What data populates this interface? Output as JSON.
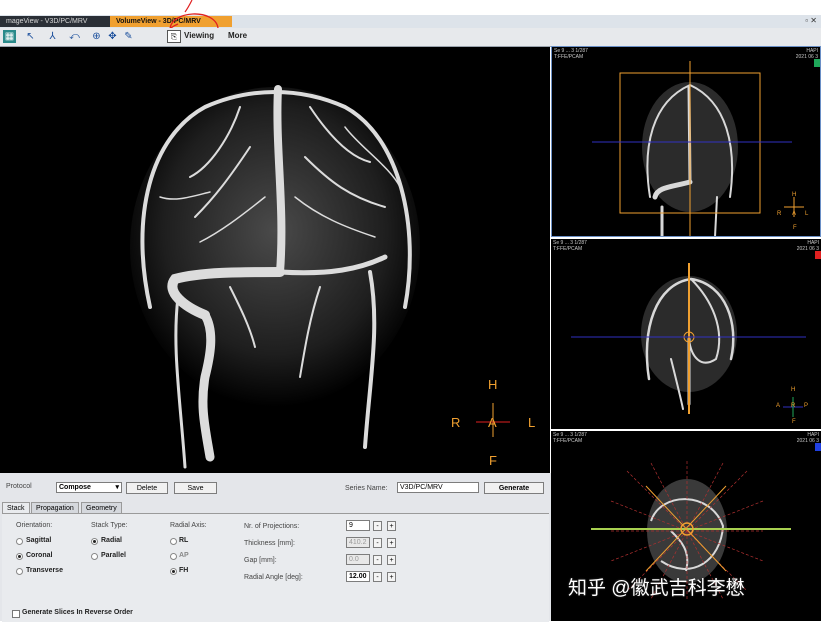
{
  "tabs": [
    {
      "label": "mageView - V3D/PC/MRV",
      "active": false
    },
    {
      "label": "VolumeView - 3D/PC/MRV",
      "active": true
    }
  ],
  "toolbar": {
    "viewing_label": "Viewing",
    "more_label": "More",
    "icons": [
      "layout-icon",
      "pointer-icon",
      "measure-icon",
      "rotate-icon",
      "zoom-icon",
      "pan-icon",
      "pen-icon",
      "viewing-icon"
    ]
  },
  "main_view": {
    "orientation": {
      "top": "H",
      "bottom": "F",
      "left": "R",
      "right": "L",
      "center": "A"
    }
  },
  "right_views": [
    {
      "info_left": "Se 9 ... 3 1/287\nT:FFE/PCAM",
      "info_right": "HAPI\n2021 06 3",
      "orient": {
        "top": "H",
        "bottom": "F",
        "left": "R",
        "right": "L",
        "center": "A"
      },
      "indicator_color": "#1fa85a"
    },
    {
      "info_left": "Se 9 ... 3 1/287\nT:FFE/PCAM",
      "info_right": "HAPI\n2021 06 3",
      "orient": {
        "top": "H",
        "bottom": "F",
        "left": "A",
        "right": "P",
        "center": "R"
      },
      "indicator_color": "#e02020"
    },
    {
      "info_left": "Se 9 ... 3 1/287\nT:FFE/PCAM",
      "info_right": "HAPI\n2021 06 3",
      "orient": {
        "top": "",
        "bottom": "",
        "left": "",
        "right": "",
        "center": ""
      },
      "indicator_color": "#2040e0"
    }
  ],
  "controls": {
    "protocol_label": "Protocol",
    "protocol_value": "Compose",
    "delete_label": "Delete",
    "save_label": "Save",
    "series_name_label": "Series Name:",
    "series_name_value": "V3D/PC/MRV",
    "generate_label": "Generate",
    "panel_tabs": [
      "Stack",
      "Propagation",
      "Geometry"
    ],
    "orientation": {
      "title": "Orientation:",
      "options": [
        "Sagittal",
        "Coronal",
        "Transverse"
      ],
      "selected": "Coronal"
    },
    "stack_type": {
      "title": "Stack Type:",
      "options": [
        "Radial",
        "Parallel"
      ],
      "selected": "Radial"
    },
    "radial_axis": {
      "title": "Radial Axis:",
      "options": [
        "RL",
        "AP",
        "FH"
      ],
      "selected": "FH"
    },
    "nr_projections": {
      "label": "Nr. of Projections:",
      "value": "9"
    },
    "thickness": {
      "label": "Thickness [mm]:",
      "value": "410.2"
    },
    "gap": {
      "label": "Gap [mm]:",
      "value": "0.0"
    },
    "radial_angle": {
      "label": "Radial Angle [deg]:",
      "value": "12.00"
    },
    "reverse_order_label": "Generate Slices In Reverse Order"
  },
  "watermark": "知乎 @徽武吉科李懋"
}
